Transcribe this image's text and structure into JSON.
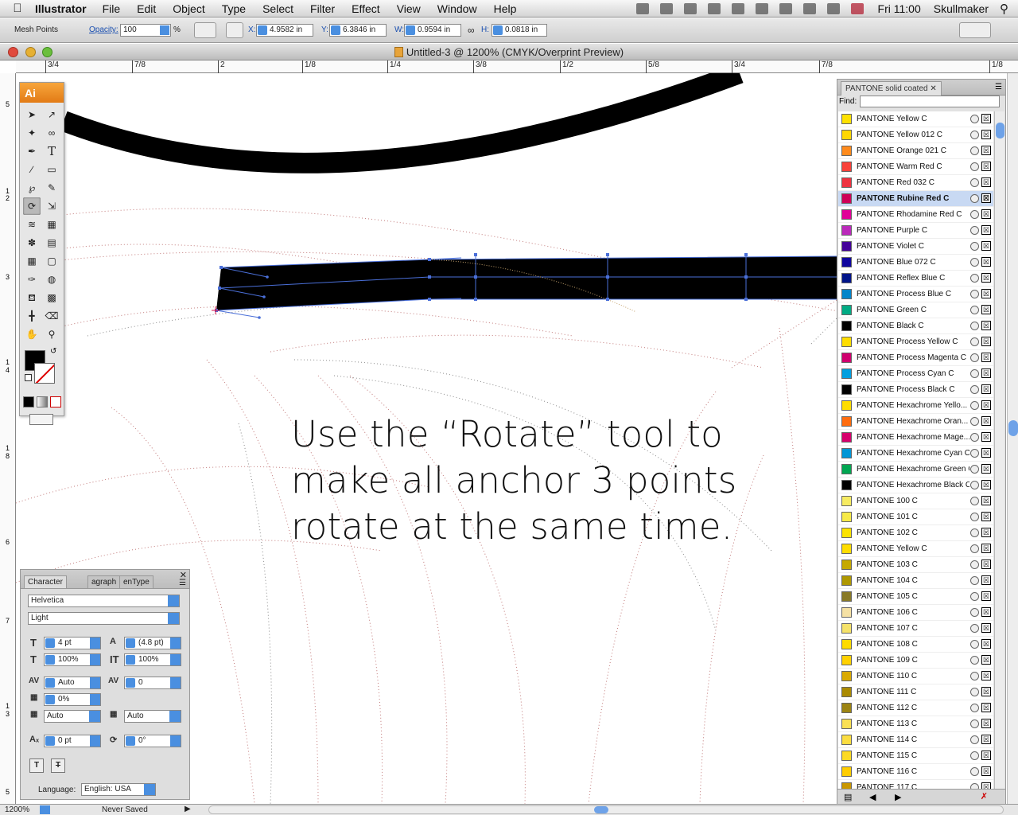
{
  "menubar": {
    "apple": "",
    "app": "Illustrator",
    "items": [
      "File",
      "Edit",
      "Object",
      "Type",
      "Select",
      "Filter",
      "Effect",
      "View",
      "Window",
      "Help"
    ],
    "clock": "Fri 11:00",
    "user": "Skullmaker"
  },
  "control": {
    "label": "Mesh Points",
    "opacity_label": "Opacity:",
    "opacity": "100",
    "percent": "%",
    "x_label": "X:",
    "x": "4.9582 in",
    "y_label": "Y:",
    "y": "6.3846 in",
    "w_label": "W:",
    "w": "0.9594 in",
    "h_label": "H:",
    "h": "0.0818 in"
  },
  "window": {
    "title": "Untitled-3 @ 1200% (CMYK/Overprint Preview)"
  },
  "ruler": {
    "h": [
      "3/4",
      "7/8",
      "2",
      "1/8",
      "1/4",
      "3/8",
      "1/2",
      "5/8",
      "3/4",
      "7/8",
      "1/8"
    ],
    "v": [
      "5",
      "1",
      "2",
      "3",
      "1",
      "4",
      "1",
      "8",
      "6",
      "7",
      "1",
      "3",
      "5"
    ]
  },
  "caption": {
    "line1": "Use the “Rotate” tool to",
    "line2": "make all anchor 3 points",
    "line3": "rotate at the same time."
  },
  "tools": {
    "header": "Ai"
  },
  "character": {
    "tabs": [
      "Character",
      "agraph",
      "enType"
    ],
    "font": "Helvetica",
    "style": "Light",
    "size": "4 pt",
    "leading": "(4.8 pt)",
    "vscale": "100%",
    "hscale": "100%",
    "kerning": "Auto",
    "tracking": "0",
    "tsume": "0%",
    "aki_left": "Auto",
    "aki_right": "Auto",
    "baseline": "0 pt",
    "rotation": "0°",
    "language_label": "Language:",
    "language": "English: USA"
  },
  "swatches": {
    "tab": "PANTONE solid coated",
    "find_label": "Find:",
    "items": [
      {
        "name": "PANTONE Yellow C",
        "color": "#fee100"
      },
      {
        "name": "PANTONE Yellow 012 C",
        "color": "#ffd700"
      },
      {
        "name": "PANTONE Orange 021 C",
        "color": "#fe8a1c"
      },
      {
        "name": "PANTONE Warm Red C",
        "color": "#f9423a"
      },
      {
        "name": "PANTONE Red 032 C",
        "color": "#ef3340"
      },
      {
        "name": "PANTONE Rubine Red C",
        "color": "#ce0058"
      },
      {
        "name": "PANTONE Rhodamine Red C",
        "color": "#e10098"
      },
      {
        "name": "PANTONE Purple C",
        "color": "#bb29bb"
      },
      {
        "name": "PANTONE Violet C",
        "color": "#440099"
      },
      {
        "name": "PANTONE Blue 072 C",
        "color": "#10069f"
      },
      {
        "name": "PANTONE Reflex Blue C",
        "color": "#001489"
      },
      {
        "name": "PANTONE Process Blue C",
        "color": "#0085ca"
      },
      {
        "name": "PANTONE Green C",
        "color": "#00ab84"
      },
      {
        "name": "PANTONE Black C",
        "color": "#000000"
      },
      {
        "name": "PANTONE Process Yellow C",
        "color": "#fedd00"
      },
      {
        "name": "PANTONE Process Magenta C",
        "color": "#d0006f"
      },
      {
        "name": "PANTONE Process Cyan C",
        "color": "#009fdf"
      },
      {
        "name": "PANTONE Process Black C",
        "color": "#000000"
      },
      {
        "name": "PANTONE Hexachrome Yello...",
        "color": "#ffdd00"
      },
      {
        "name": "PANTONE Hexachrome Oran...",
        "color": "#ff6c0e"
      },
      {
        "name": "PANTONE Hexachrome Mage...",
        "color": "#d6006d"
      },
      {
        "name": "PANTONE Hexachrome Cyan C",
        "color": "#0096d6"
      },
      {
        "name": "PANTONE Hexachrome Green C",
        "color": "#00a651"
      },
      {
        "name": "PANTONE Hexachrome Black C",
        "color": "#000000"
      },
      {
        "name": "PANTONE 100 C",
        "color": "#f6eb61"
      },
      {
        "name": "PANTONE 101 C",
        "color": "#f7ea48"
      },
      {
        "name": "PANTONE 102 C",
        "color": "#fce300"
      },
      {
        "name": "PANTONE Yellow C",
        "color": "#fedd00"
      },
      {
        "name": "PANTONE 103 C",
        "color": "#c5a900"
      },
      {
        "name": "PANTONE 104 C",
        "color": "#af9800"
      },
      {
        "name": "PANTONE 105 C",
        "color": "#897a27"
      },
      {
        "name": "PANTONE 106 C",
        "color": "#f5e1a4"
      },
      {
        "name": "PANTONE 107 C",
        "color": "#f5e26a"
      },
      {
        "name": "PANTONE 108 C",
        "color": "#fedb00"
      },
      {
        "name": "PANTONE 109 C",
        "color": "#ffd100"
      },
      {
        "name": "PANTONE 110 C",
        "color": "#daaa00"
      },
      {
        "name": "PANTONE 111 C",
        "color": "#aa8a00"
      },
      {
        "name": "PANTONE 112 C",
        "color": "#9c8412"
      },
      {
        "name": "PANTONE 113 C",
        "color": "#fae053"
      },
      {
        "name": "PANTONE 114 C",
        "color": "#fbdd40"
      },
      {
        "name": "PANTONE 115 C",
        "color": "#fdda24"
      },
      {
        "name": "PANTONE 116 C",
        "color": "#ffcd00"
      },
      {
        "name": "PANTONE 117 C",
        "color": "#c99700"
      }
    ]
  },
  "status": {
    "zoom": "1200%",
    "state": "Never Saved"
  }
}
